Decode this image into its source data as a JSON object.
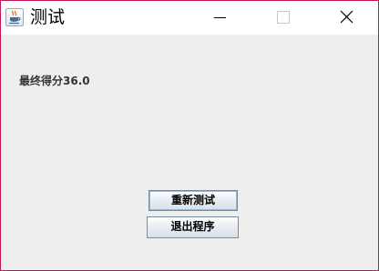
{
  "window": {
    "title": "测试",
    "app_icon": "java-coffee-icon"
  },
  "titlebar": {
    "minimize_icon": "minimize-icon",
    "maximize_icon": "maximize-icon",
    "close_icon": "close-icon"
  },
  "content": {
    "score_text": "最终得分36.0"
  },
  "buttons": {
    "retest_label": "重新测试",
    "exit_label": "退出程序"
  },
  "colors": {
    "window_border": "#c2185b",
    "background": "#eeeeee",
    "titlebar": "#ffffff"
  }
}
